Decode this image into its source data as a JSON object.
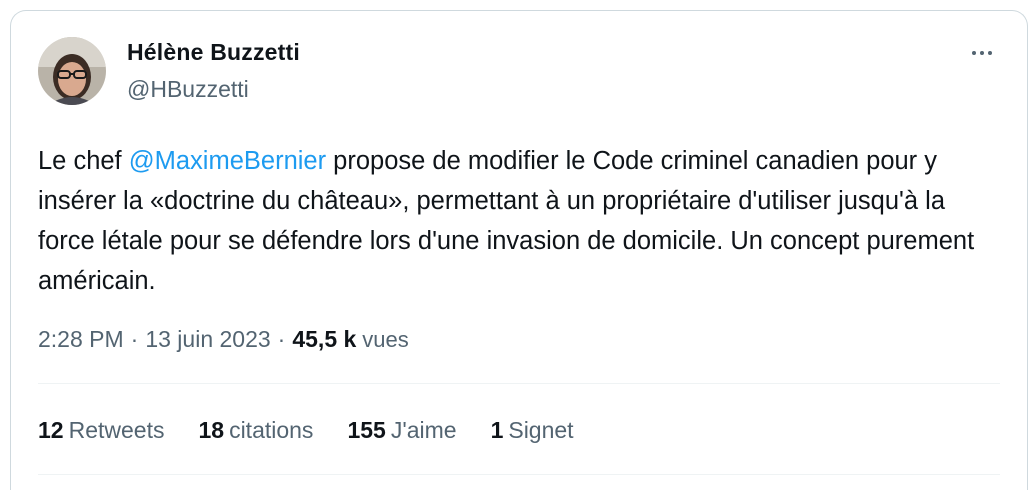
{
  "author": {
    "name": "Hélène Buzzetti",
    "handle": "@HBuzzetti"
  },
  "more_button": {
    "icon": "more-horizontal-icon"
  },
  "tweet": {
    "text_before": "Le chef ",
    "mention": "@MaximeBernier",
    "text_after": " propose de modifier le Code criminel canadien pour y insérer la «doctrine du château», permettant à un propriétaire d'utiliser jusqu'à la force létale pour se défendre lors d'une invasion de domicile. Un concept purement américain."
  },
  "meta": {
    "time": "2:28 PM",
    "separator": "·",
    "date": "13 juin 2023",
    "views_count": "45,5 k",
    "views_label": "vues"
  },
  "stats": {
    "retweets_count": "12",
    "retweets_label": "Retweets",
    "citations_count": "18",
    "citations_label": "citations",
    "likes_count": "155",
    "likes_label": "J'aime",
    "bookmarks_count": "1",
    "bookmarks_label": "Signet"
  },
  "colors": {
    "accent": "#1d9bf0",
    "text_primary": "#0f1419",
    "text_secondary": "#536471",
    "border": "#cfd9de"
  }
}
